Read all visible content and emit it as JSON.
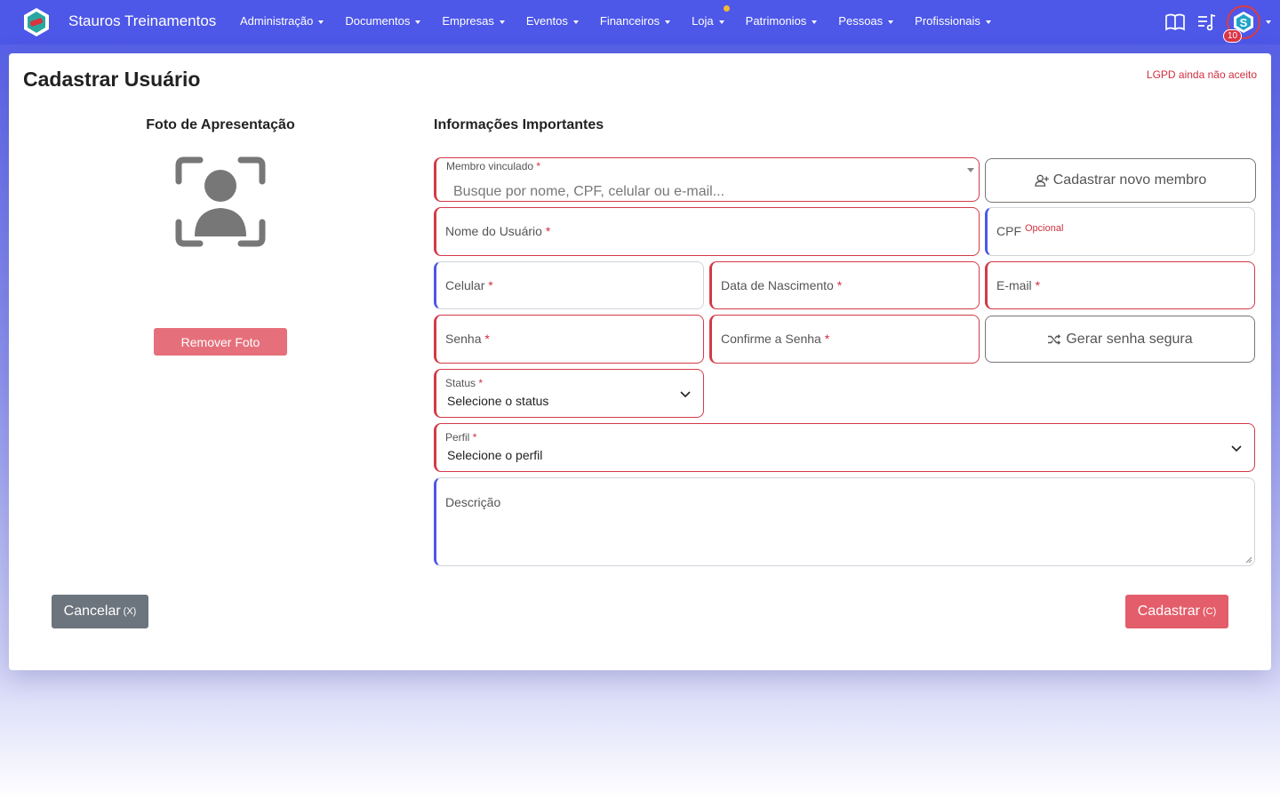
{
  "navbar": {
    "brand": "Stauros Treinamentos",
    "menu": [
      {
        "label": "Administração"
      },
      {
        "label": "Documentos"
      },
      {
        "label": "Empresas"
      },
      {
        "label": "Eventos"
      },
      {
        "label": "Financeiros"
      },
      {
        "label": "Loja"
      },
      {
        "label": "Patrimonios"
      },
      {
        "label": "Pessoas"
      },
      {
        "label": "Profissionais"
      }
    ],
    "notification_count": "10",
    "icons": [
      "book-icon",
      "playlist-icon",
      "user-avatar"
    ]
  },
  "page": {
    "title": "Cadastrar Usuário",
    "lgpd_status": "LGPD ainda não aceito"
  },
  "photo": {
    "title": "Foto de Apresentação",
    "remove_label": "Remover Foto"
  },
  "form": {
    "title": "Informações Importantes",
    "membro_label": "Membro vinculado",
    "membro_placeholder": "Busque por nome, CPF, celular ou e-mail...",
    "new_member_label": "Cadastrar novo membro",
    "nome_label": "Nome do Usuário",
    "cpf_label": "CPF",
    "cpf_optional": "Opcional",
    "celular_label": "Celular",
    "nascimento_label": "Data de Nascimento",
    "email_label": "E-mail",
    "senha_label": "Senha",
    "confirme_label": "Confirme a Senha",
    "gerar_label": "Gerar senha segura",
    "status_label": "Status",
    "status_value": "Selecione o status",
    "perfil_label": "Perfil",
    "perfil_value": "Selecione o perfil",
    "descricao_label": "Descrição",
    "required_mark": "*"
  },
  "actions": {
    "cancel_label": "Cancelar",
    "cancel_shortcut": "(X)",
    "submit_label": "Cadastrar",
    "submit_shortcut": "(C)"
  },
  "colors": {
    "navbar": "#4d57e8",
    "required_border": "#d33a48",
    "optional_border": "#4d57e8",
    "submit": "#e35d6a",
    "cancel": "#6c757d"
  }
}
